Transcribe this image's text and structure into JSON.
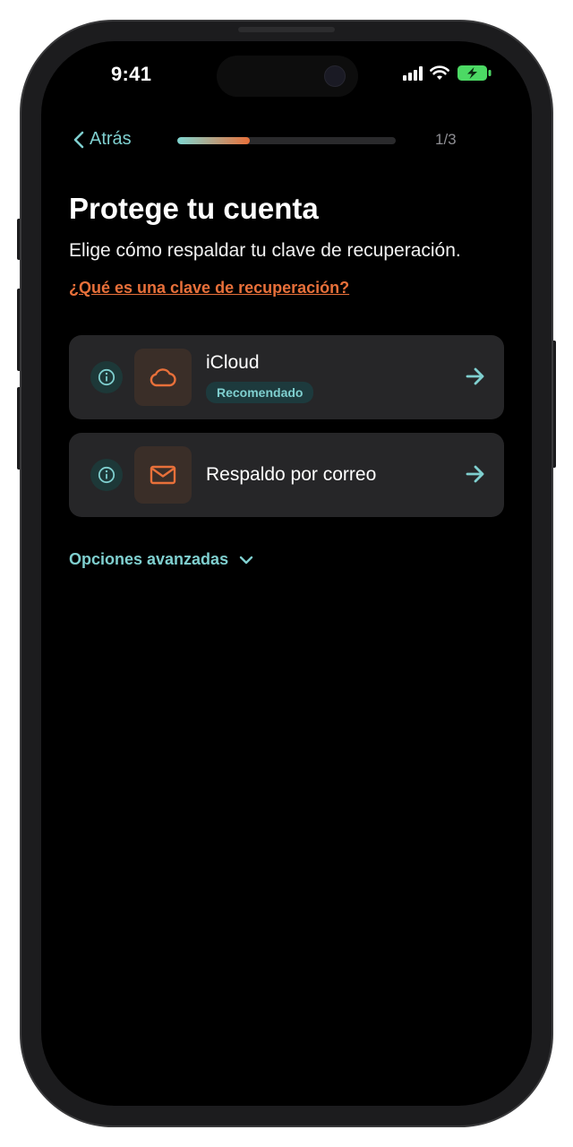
{
  "status_bar": {
    "time": "9:41"
  },
  "nav": {
    "back_label": "Atrás",
    "progress_fraction": 0.333,
    "step_indicator": "1/3"
  },
  "content": {
    "title": "Protege tu cuenta",
    "subtitle": "Elige cómo respaldar tu clave de recuperación.",
    "help_link": "¿Qué es una clave de recuperación?"
  },
  "options": [
    {
      "title": "iCloud",
      "badge": "Recomendado",
      "icon": "cloud-icon"
    },
    {
      "title": "Respaldo por correo",
      "icon": "mail-icon"
    }
  ],
  "advanced": {
    "label": "Opciones avanzadas"
  },
  "colors": {
    "accent_teal": "#7fcfcf",
    "accent_orange": "#e8703a",
    "card_bg": "#262628",
    "battery_green": "#4cd964"
  }
}
